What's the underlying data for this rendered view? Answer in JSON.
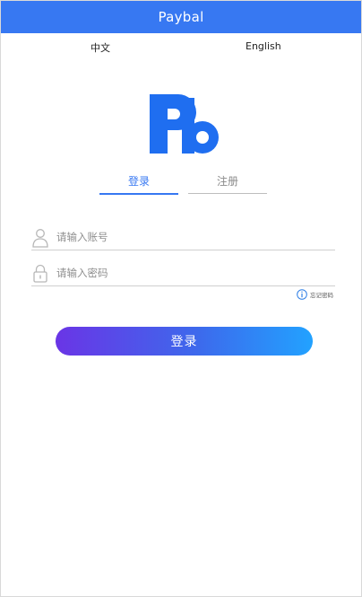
{
  "header": {
    "title": "Paybal"
  },
  "language": {
    "chinese_label": "中文",
    "english_label": "English"
  },
  "logo": {
    "icon": "pb-logo",
    "color": "#1f6ef0"
  },
  "tabs": [
    {
      "label": "登录",
      "active": true
    },
    {
      "label": "注册",
      "active": false
    }
  ],
  "form": {
    "account": {
      "icon": "user-icon",
      "placeholder": "请输入账号",
      "value": ""
    },
    "password": {
      "icon": "lock-icon",
      "placeholder": "请输入密码",
      "value": ""
    },
    "forgot_password": {
      "icon": "info-icon",
      "label": "忘记密码"
    },
    "submit_label": "登录"
  },
  "colors": {
    "header_bg": "#3778f2",
    "accent": "#3778f2",
    "button_gradient_start": "#6a35e6",
    "button_gradient_end": "#22a2ff"
  }
}
